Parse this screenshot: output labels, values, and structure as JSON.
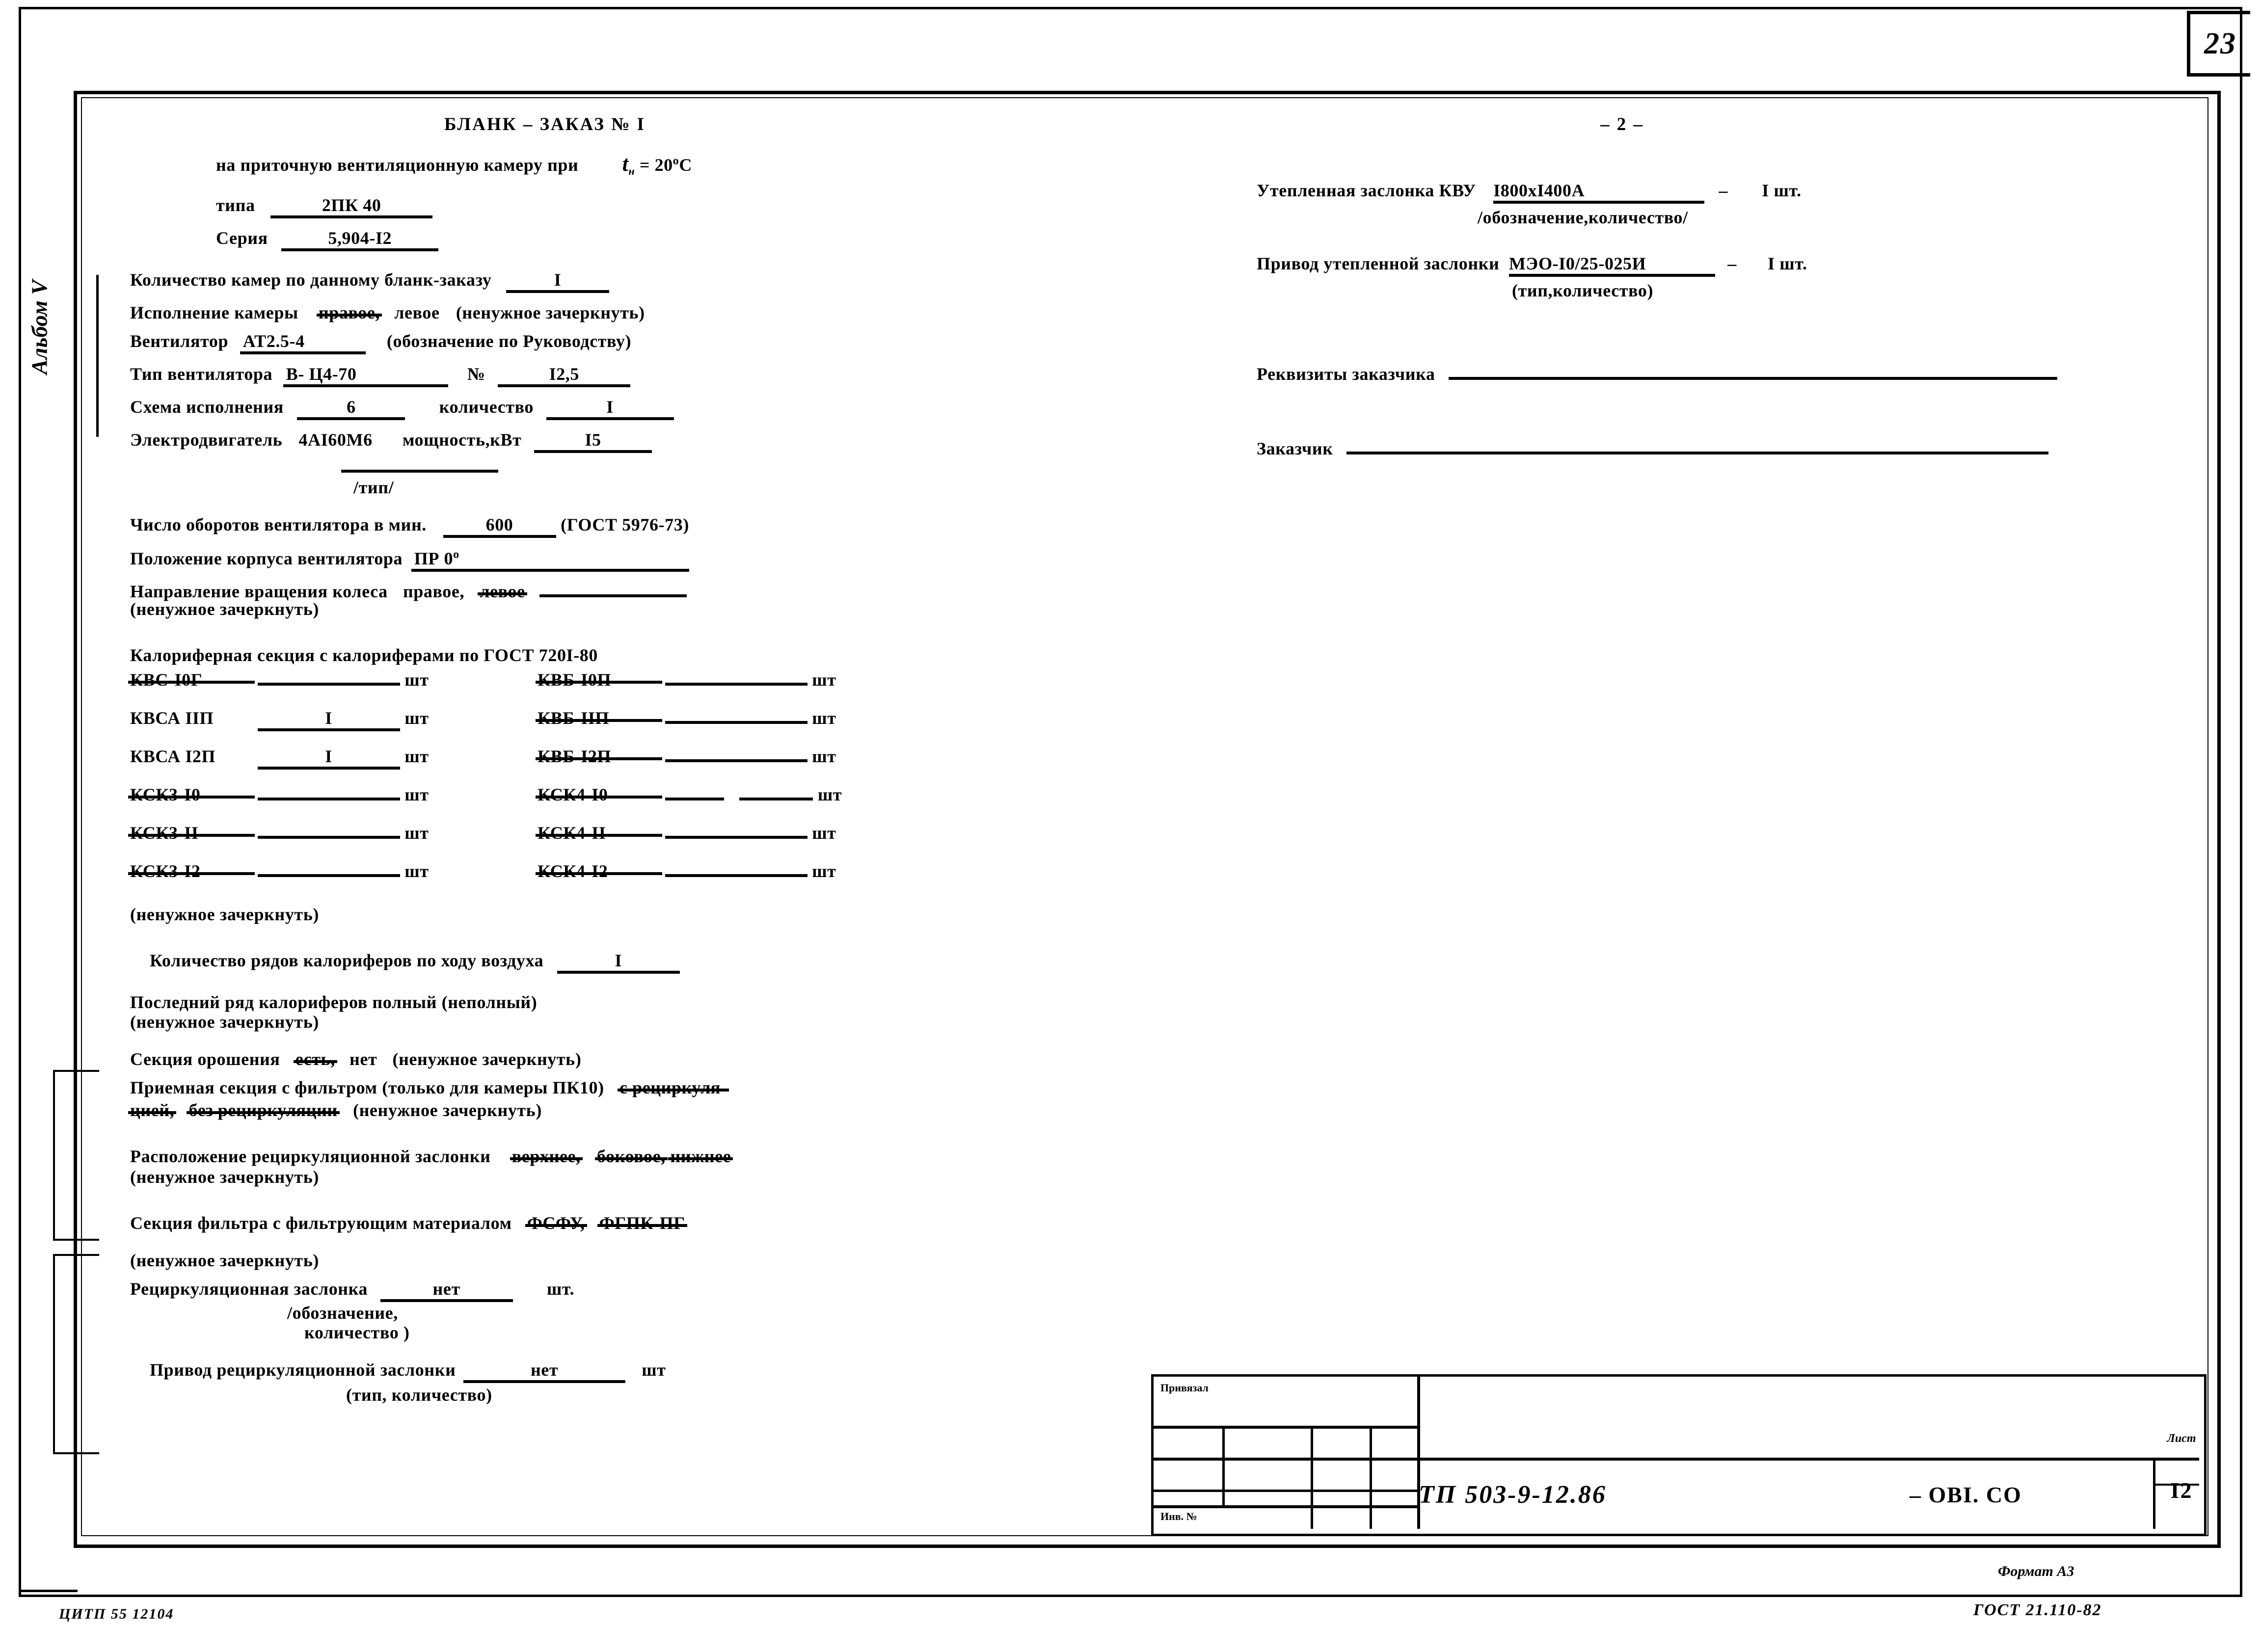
{
  "page": {
    "number": "23",
    "album_label": "Альбом V",
    "format_note": "Формат А3",
    "gost_bottom": "ГОСТ 21.110-82",
    "citp_code": "ЦИТП 55 12104"
  },
  "left_column": {
    "title": "БЛАНК – ЗАКАЗ № I",
    "subtitle_prefix": "на приточную вентиляционную камеру при",
    "subtitle_var": "t",
    "subtitle_var_sub": "н",
    "subtitle_value": "= 20",
    "subtitle_unit": "o",
    "subtitle_unit2": "С",
    "type_label": "типа",
    "type_value": "2ПК  40",
    "series_label": "Серия",
    "series_value": "5,904-I2",
    "qty_cameras_label": "Количество камер по данному бланк-заказу",
    "qty_cameras_value": "I",
    "execution_label": "Исполнение камеры",
    "execution_opt1": "правое,",
    "execution_opt2": "левое",
    "execution_note": "(ненужное зачеркнуть)",
    "fan_label": "Вентилятор",
    "fan_value": "АТ2.5-4",
    "fan_note": "(обозначение по Руководству)",
    "fan_type_label": "Тип вентилятора",
    "fan_type_value": "В- Ц4-70",
    "fan_number_symbol": "№",
    "fan_number_value": "I2,5",
    "scheme_label": "Схема исполнения",
    "scheme_value": "6",
    "scheme_qty_label": "количество",
    "scheme_qty_value": "I",
    "motor_label": "Электродвигатель",
    "motor_value": "4АI60М6",
    "motor_power_label": "мощность,кВт",
    "motor_power_value": "I5",
    "motor_type_note": "/тип/",
    "rpm_label": "Число оборотов вентилятора в мин.",
    "rpm_value": "600",
    "rpm_gost": "(ГОСТ 5976-73)",
    "housing_label": "Положение корпуса вентилятора",
    "housing_value": "ПР 0",
    "housing_unit": "о",
    "rotation_label": "Направление вращения колеса",
    "rotation_opt1": "правое,",
    "rotation_opt2": "левое",
    "rotation_note": "(ненужное зачеркнуть)",
    "heater_section_title": "Калориферная секция с калориферами по ГОСТ 720I-80",
    "heater_rows": [
      {
        "left_label": "КВС-I0Г",
        "left_struck": true,
        "left_value": "",
        "left_unit": "шт",
        "right_label": "КВБ-I0П",
        "right_struck": true,
        "right_value": "",
        "right_unit": "шт"
      },
      {
        "left_label": "КВСА IIП",
        "left_struck": false,
        "left_value": "I",
        "left_unit": "шт",
        "right_label": "КВБ-IIП",
        "right_struck": true,
        "right_value": "",
        "right_unit": "шт"
      },
      {
        "left_label": "КВСА I2П",
        "left_struck": false,
        "left_value": "I",
        "left_unit": "шт",
        "right_label": "КВБ-I2П",
        "right_struck": true,
        "right_value": "",
        "right_unit": "шт"
      },
      {
        "left_label": "КСК3-I0",
        "left_struck": true,
        "left_value": "",
        "left_unit": "шт",
        "right_label": "КСК4-I0",
        "right_struck": true,
        "right_value": "",
        "right_unit": "шт"
      },
      {
        "left_label": "КСК3-II",
        "left_struck": true,
        "left_value": "",
        "left_unit": "шт",
        "right_label": "КСК4-II",
        "right_struck": true,
        "right_value": "",
        "right_unit": "шт"
      },
      {
        "left_label": "КСК3-I2",
        "left_struck": true,
        "left_value": "",
        "left_unit": "шт",
        "right_label": "КСК4-I2",
        "right_struck": true,
        "right_value": "",
        "right_unit": "шт"
      }
    ],
    "heater_note": "(ненужное зачеркнуть)",
    "rows_count_label": "Количество рядов калориферов по ходу воздуха",
    "rows_count_value": "I",
    "last_row_label": "Последний ряд калориферов полный (неполный)",
    "last_row_note": "(ненужное зачеркнуть)",
    "irrigation_label": "Секция орошения",
    "irrigation_opt1": "есть,",
    "irrigation_opt2": "нет",
    "irrigation_note": "(ненужное зачеркнуть)",
    "intake_label": "Приемная секция с фильтром (только для камеры ПК10)",
    "intake_opt1": "с рециркуля-",
    "intake_opt2": "цией,",
    "intake_opt3": "без рециркуляции",
    "intake_note": "(ненужное зачеркнуть)",
    "recirc_pos_label": "Расположение рециркуляционной заслонки",
    "recirc_pos_opt1": "верхнее,",
    "recirc_pos_opt2": "боковое,",
    "recirc_pos_opt3": "нижнее",
    "recirc_pos_note": "(ненужное зачеркнуть)",
    "filter_label": "Секция фильтра с фильтрующим материалом",
    "filter_opt1": "ФСФУ,",
    "filter_opt2": "ФГПК-ПГ",
    "filter_note": "(ненужное зачеркнуть)",
    "recirc_damper_label": "Рециркуляционная заслонка",
    "recirc_damper_value": "нет",
    "recirc_damper_unit": "шт.",
    "recirc_damper_note1": "/обозначение,",
    "recirc_damper_note2": "количество )",
    "recirc_drive_label": "Привод рециркуляционной заслонки",
    "recirc_drive_value": "нет",
    "recirc_drive_unit": "шт",
    "recirc_drive_note": "(тип, количество)"
  },
  "right_column": {
    "page_marker": "– 2 –",
    "insul_damper_label": "Утепленная заслонка КВУ",
    "insul_damper_value": "I800xI400А",
    "insul_damper_dash": "–",
    "insul_damper_qty": "I шт.",
    "insul_damper_note": "/обозначение,количество/",
    "insul_drive_label": "Привод утепленной заслонки",
    "insul_drive_value": "МЭО-I0/25-025И",
    "insul_drive_dash": "–",
    "insul_drive_qty": "I шт.",
    "insul_drive_note": "(тип,количество)",
    "requisites_label": "Реквизиты заказчика",
    "customer_label": "Заказчик"
  },
  "stamp": {
    "attached_label": "Привязал",
    "inv_label": "Инв. №",
    "code": "ТП 503-9-12.86",
    "mark": "– ОВI. СО",
    "sheet_label": "Лист",
    "sheet_value": "I2"
  }
}
